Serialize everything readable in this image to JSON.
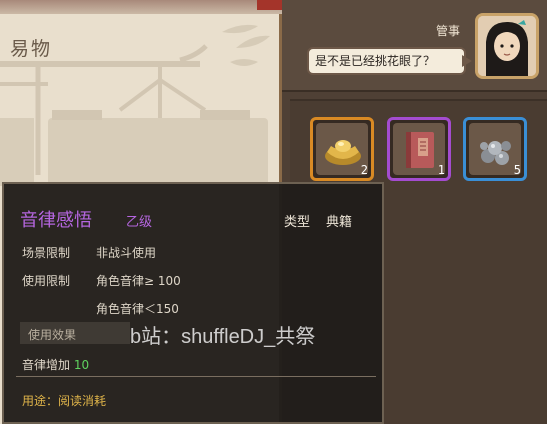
{
  "left_panel": {
    "title": "易物"
  },
  "npc": {
    "name": "管事",
    "speech": "是不是已经挑花眼了？"
  },
  "inventory": [
    {
      "icon": "gold-ingot-icon",
      "count": "2",
      "rarity_color": "#d98a24"
    },
    {
      "icon": "red-book-icon",
      "count": "1",
      "rarity_color": "#a44cd0"
    },
    {
      "icon": "ore-pile-icon",
      "count": "5",
      "rarity_color": "#3a8fd6"
    }
  ],
  "tooltip": {
    "name": "音律感悟",
    "grade": "乙级",
    "type_label": "类型",
    "type_value": "典籍",
    "scene_label": "场景限制",
    "scene_value": "非战斗使用",
    "use_label": "使用限制",
    "req1": "角色音律≥ 100",
    "req2": "角色音律＜150",
    "effect_label": "使用效果",
    "effect_text": "音律增加",
    "effect_value": "10",
    "usage": "用途：阅读消耗"
  },
  "watermark": "b站：shuffleDJ_共祭"
}
